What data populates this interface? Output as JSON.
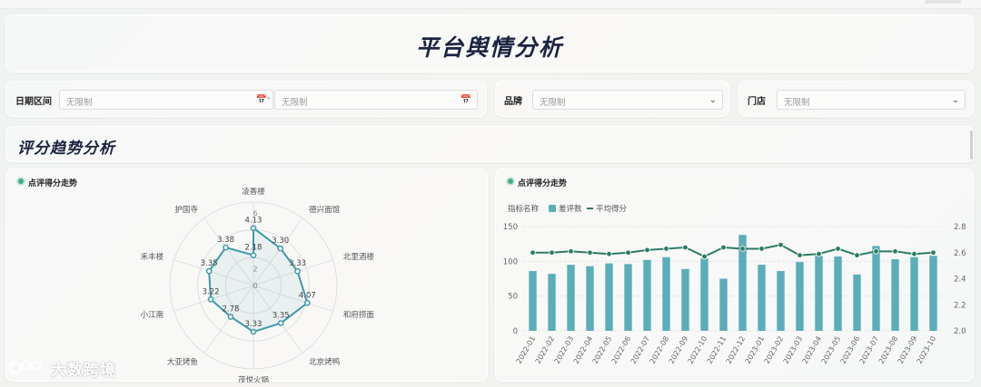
{
  "page": {
    "title": "平台舆情分析"
  },
  "filters": {
    "date_label": "日期区间",
    "date_start_placeholder": "无限制",
    "date_separator": "-",
    "date_end_placeholder": "无限制",
    "brand_label": "品牌",
    "brand_placeholder": "无限制",
    "store_label": "门店",
    "store_placeholder": "无限制"
  },
  "section": {
    "title": "评分趋势分析"
  },
  "radar_card": {
    "title": "点评得分走势"
  },
  "bar_card": {
    "title": "点评得分走势"
  },
  "watermark": {
    "text": "大数跨境"
  },
  "chart_data": [
    {
      "type": "radar",
      "categories": [
        "凌香楼",
        "德兴面馆",
        "北里酒楼",
        "和府捞面",
        "北京烤鸭",
        "茂悦火锅",
        "大亚烤鱼",
        "小江南",
        "禾丰楼",
        "护国寺"
      ],
      "values": [
        4.13,
        3.3,
        3.33,
        4.07,
        3.35,
        3.33,
        2.78,
        3.22,
        3.35,
        3.38,
        2.18
      ],
      "value_labels": [
        "4.13",
        "3.30",
        "3.33",
        "4.07",
        "3.35",
        "3.33",
        "2.78",
        "3.22",
        "3.35",
        "3.38",
        "2.18"
      ],
      "ticks": [
        "6",
        "2",
        "0"
      ],
      "rmax": 6,
      "color": "#3f9aa8"
    },
    {
      "type": "bar+line",
      "legend_title": "指标名称",
      "categories": [
        "2022-01",
        "2022-02",
        "2022-03",
        "2022-04",
        "2022-05",
        "2022-06",
        "2022-07",
        "2022-08",
        "2022-09",
        "2022-10",
        "2022-11",
        "2022-12",
        "2023-01",
        "2023-02",
        "2023-03",
        "2023-04",
        "2023-05",
        "2023-06",
        "2023-07",
        "2023-08",
        "2023-09",
        "2023-10"
      ],
      "series": [
        {
          "name": "差评数",
          "type": "bar",
          "axis": "left",
          "color": "#5aaeb8",
          "values": [
            86,
            82,
            95,
            93,
            97,
            96,
            102,
            106,
            89,
            104,
            75,
            138,
            95,
            86,
            99,
            108,
            107,
            81,
            122,
            103,
            106,
            108
          ]
        },
        {
          "name": "平均得分",
          "type": "line",
          "axis": "right",
          "color": "#2b7a66",
          "values": [
            2.6,
            2.6,
            2.61,
            2.6,
            2.59,
            2.6,
            2.62,
            2.63,
            2.64,
            2.57,
            2.64,
            2.63,
            2.63,
            2.66,
            2.58,
            2.59,
            2.63,
            2.58,
            2.61,
            2.61,
            2.59,
            2.6
          ]
        }
      ],
      "y_left": {
        "min": 0,
        "max": 150,
        "ticks": [
          "0",
          "50",
          "100",
          "150"
        ]
      },
      "y_right": {
        "min": 2.0,
        "max": 2.8,
        "ticks": [
          "2.0",
          "2.2",
          "2.4",
          "2.6",
          "2.8"
        ]
      }
    }
  ]
}
